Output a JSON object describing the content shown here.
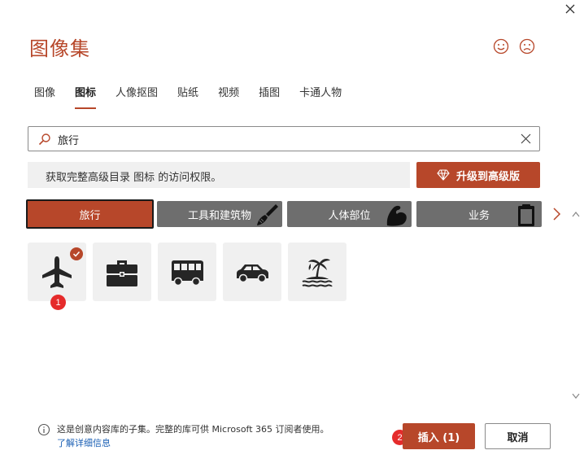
{
  "dialog": {
    "title": "图像集"
  },
  "tabs": [
    {
      "label": "图像",
      "active": false
    },
    {
      "label": "图标",
      "active": true
    },
    {
      "label": "人像抠图",
      "active": false
    },
    {
      "label": "贴纸",
      "active": false
    },
    {
      "label": "视频",
      "active": false
    },
    {
      "label": "插图",
      "active": false
    },
    {
      "label": "卡通人物",
      "active": false
    }
  ],
  "search": {
    "value": "旅行",
    "placeholder": ""
  },
  "promo": {
    "text": "获取完整高级目录 图标 的访问权限。",
    "upgrade_label": "升级到高级版"
  },
  "categories": [
    {
      "label": "旅行",
      "selected": true,
      "icon": "none"
    },
    {
      "label": "工具和建筑物",
      "selected": false,
      "icon": "paintbrush-icon"
    },
    {
      "label": "人体部位",
      "selected": false,
      "icon": "bicep-icon"
    },
    {
      "label": "业务",
      "selected": false,
      "icon": "clipboard-icon"
    }
  ],
  "icons": [
    {
      "name": "airplane",
      "selected": true
    },
    {
      "name": "briefcase",
      "selected": false
    },
    {
      "name": "bus",
      "selected": false
    },
    {
      "name": "car",
      "selected": false
    },
    {
      "name": "island",
      "selected": false
    }
  ],
  "badges": {
    "first": "1",
    "second": "2"
  },
  "footer": {
    "info_text": "这是创意内容库的子集。完整的库可供 Microsoft 365 订阅者使用。",
    "link_label": "了解详细信息",
    "insert_label": "插入 (1)",
    "cancel_label": "取消"
  },
  "colors": {
    "accent": "#b7472a",
    "category_bg": "#6e6e6e",
    "tile_bg": "#f0f0f0",
    "badge": "#e52b2b",
    "link": "#1a5fb4"
  }
}
